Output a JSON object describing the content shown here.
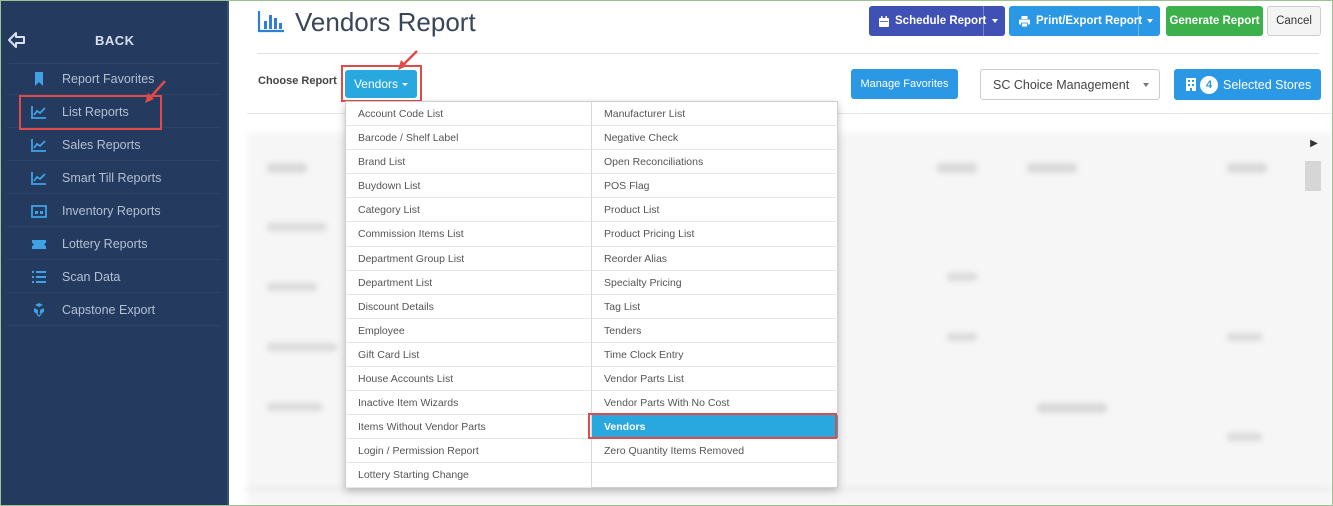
{
  "sidebar": {
    "back_label": "BACK",
    "items": [
      {
        "label": "Report Favorites",
        "icon": "bookmark-icon"
      },
      {
        "label": "List Reports",
        "icon": "chart-line-icon"
      },
      {
        "label": "Sales Reports",
        "icon": "chart-line-icon"
      },
      {
        "label": "Smart Till Reports",
        "icon": "chart-line-icon"
      },
      {
        "label": "Inventory Reports",
        "icon": "warehouse-icon"
      },
      {
        "label": "Lottery Reports",
        "icon": "ticket-icon"
      },
      {
        "label": "Scan Data",
        "icon": "list-icon"
      },
      {
        "label": "Capstone Export",
        "icon": "cubes-icon"
      }
    ]
  },
  "header": {
    "title": "Vendors Report",
    "schedule_label": "Schedule Report",
    "print_label": "Print/Export Report",
    "generate_label": "Generate Report",
    "cancel_label": "Cancel"
  },
  "toolbar": {
    "choose_label": "Choose Report",
    "selected_report": "Vendors",
    "manage_favorites": "Manage Favorites",
    "store_group": "SC Choice Management",
    "selected_stores_count": "4",
    "selected_stores_label": "Selected Stores"
  },
  "menu": {
    "left": [
      "Account Code List",
      "Barcode / Shelf Label",
      "Brand List",
      "Buydown List",
      "Category List",
      "Commission Items List",
      "Department Group List",
      "Department List",
      "Discount Details",
      "Employee",
      "Gift Card List",
      "House Accounts List",
      "Inactive Item Wizards",
      "Items Without Vendor Parts",
      "Login / Permission Report",
      "Lottery Starting Change"
    ],
    "right": [
      "Manufacturer List",
      "Negative Check",
      "Open Reconciliations",
      "POS Flag",
      "Product List",
      "Product Pricing List",
      "Reorder Alias",
      "Specialty Pricing",
      "Tag List",
      "Tenders",
      "Time Clock Entry",
      "Vendor Parts List",
      "Vendor Parts With No Cost",
      "Vendors",
      "Zero Quantity Items Removed"
    ],
    "active": "Vendors"
  },
  "colors": {
    "sidebar_bg": "#243a5e",
    "accent": "#29a8e0",
    "schedule_btn": "#3f51b5",
    "generate_btn": "#3cb04a",
    "callout": "#e24a4a"
  }
}
